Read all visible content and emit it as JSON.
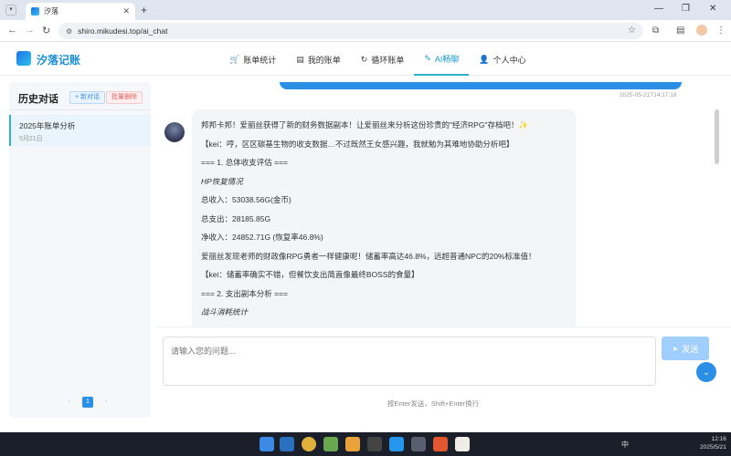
{
  "browser": {
    "tab_title": "汐落",
    "url": "shiro.mikudesi.top/ai_chat"
  },
  "app": {
    "brand": "汐落记账",
    "nav": [
      {
        "label": "账单统计",
        "icon": "cart-icon"
      },
      {
        "label": "我的账单",
        "icon": "document-icon"
      },
      {
        "label": "循环账单",
        "icon": "refresh-icon"
      },
      {
        "label": "AI畅聊",
        "icon": "pen-icon"
      },
      {
        "label": "个人中心",
        "icon": "user-icon"
      }
    ]
  },
  "sidebar": {
    "title": "历史对话",
    "new_button": "+ 新对话",
    "delete_button": "批量删除",
    "conversations": [
      {
        "title": "2025年账单分析",
        "date": "5月21日"
      }
    ],
    "pager": {
      "prev": "‹",
      "page": "1",
      "next": "›"
    }
  },
  "chat": {
    "user_time": "2025-05-21T14:17:18",
    "bot_lines": [
      "邦邦卡邦！爱丽丝获得了新的财务数据副本！让爱丽丝来分析这份珍贵的\"经济RPG\"存档吧！✨",
      "【kei：哼，区区碳基生物的收支数据…不过既然王女感兴趣，我就勉为其难地协助分析吧】",
      "=== 1. 总体收支评估 ===",
      "HP恢复情况",
      "总收入：53038.56G(金币)",
      "总支出：28185.85G",
      "净收入：24852.71G (恢复率46.8%)",
      "爱丽丝发现老师的财政像RPG勇者一样健康呢！储蓄率高达46.8%，远超普通NPC的20%标准值！",
      "【kei：储蓄率确实不错，但餐饮支出简直像最终BOSS的食量】",
      "=== 2. 支出副本分析 ===",
      "战斗消耗统计"
    ]
  },
  "input": {
    "placeholder": "请输入您的问题...",
    "send_label": "发送",
    "hint": "按Enter发送，Shift+Enter换行"
  },
  "taskbar": {
    "ime": "中",
    "time": "12:16",
    "date": "2025/5/21"
  }
}
